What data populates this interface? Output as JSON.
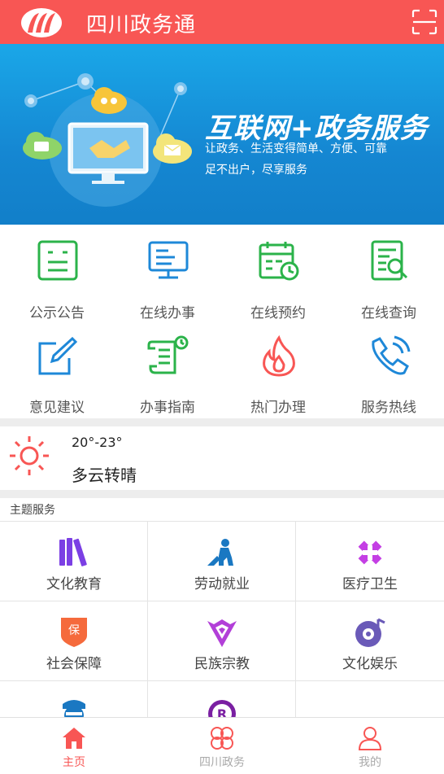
{
  "header": {
    "title": "四川政务通",
    "logo_icon": "sichuan-logo-icon",
    "scan_icon": "scan-icon",
    "color": "#f85654"
  },
  "banner": {
    "title": "互联网+政务服务",
    "subtitle_line1": "让政务、生活变得简单、方便、可靠",
    "subtitle_line2": "足不出户，尽享服务"
  },
  "quick_services": [
    {
      "label": "公示公告",
      "icon": "notice-board-icon",
      "color": "#2bb34a"
    },
    {
      "label": "在线办事",
      "icon": "monitor-icon",
      "color": "#1e88d8"
    },
    {
      "label": "在线预约",
      "icon": "calendar-clock-icon",
      "color": "#2bb34a"
    },
    {
      "label": "在线查询",
      "icon": "document-search-icon",
      "color": "#2bb34a"
    },
    {
      "label": "意见建议",
      "icon": "edit-pen-icon",
      "color": "#1e88d8"
    },
    {
      "label": "办事指南",
      "icon": "guide-scroll-icon",
      "color": "#2bb34a"
    },
    {
      "label": "热门办理",
      "icon": "flame-icon",
      "color": "#f85654"
    },
    {
      "label": "服务热线",
      "icon": "phone-icon",
      "color": "#1e88d8"
    }
  ],
  "weather": {
    "temperature": "20°-23°",
    "description": "多云转晴",
    "icon": "sun-icon"
  },
  "theme": {
    "title": "主题服务",
    "items": [
      {
        "label": "文化教育",
        "icon": "books-icon",
        "color": "#7b3fe4"
      },
      {
        "label": "劳动就业",
        "icon": "worker-icon",
        "color": "#1a78c2"
      },
      {
        "label": "医疗卫生",
        "icon": "medical-cross-icon",
        "color": "#c43fe4"
      },
      {
        "label": "社会保障",
        "icon": "shield-bao-icon",
        "color": "#f56a3c"
      },
      {
        "label": "民族宗教",
        "icon": "ethnic-ornament-icon",
        "color": "#b23fd8"
      },
      {
        "label": "文化娱乐",
        "icon": "music-disc-icon",
        "color": "#6a5ab8"
      },
      {
        "label": "",
        "icon": "police-icon",
        "color": "#1a78c2"
      },
      {
        "label": "",
        "icon": "badge-r-icon",
        "color": "#7a1fa2"
      },
      {
        "label": "",
        "icon": "more-dots-icon",
        "color": "#222222"
      }
    ]
  },
  "tabbar": {
    "items": [
      {
        "label": "主页",
        "icon": "home-icon",
        "active": true
      },
      {
        "label": "四川政务",
        "icon": "clover-icon",
        "active": false
      },
      {
        "label": "我的",
        "icon": "user-icon",
        "active": false
      }
    ]
  }
}
